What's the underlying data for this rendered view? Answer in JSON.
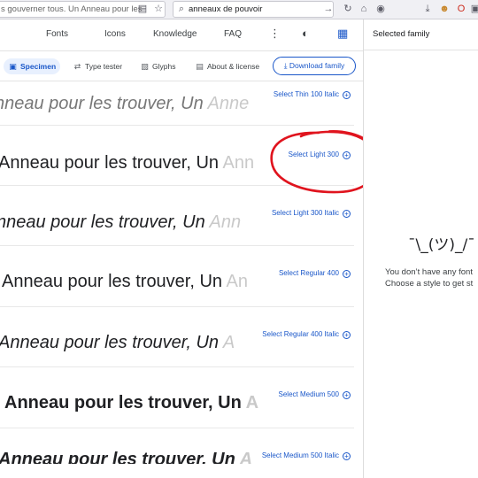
{
  "browser": {
    "tab_url_text": "s gouverner tous. Un Anneau pour les tr",
    "search_text": "anneaux de pouvoir"
  },
  "nav": {
    "fonts": "Fonts",
    "icons": "Icons",
    "knowledge": "Knowledge",
    "faq": "FAQ"
  },
  "tabs": {
    "specimen": "Specimen",
    "type_tester": "Type tester",
    "glyphs": "Glyphs",
    "about": "About & license",
    "download": "Download family"
  },
  "rows": [
    {
      "sample": "nneau pour les trouver, Un Anne",
      "select": "Select Thin 100 Italic"
    },
    {
      "sample": "Anneau pour les trouver, Un Ann",
      "select": "Select Light 300"
    },
    {
      "sample": "nneau pour les trouver, Un Ann",
      "select": "Select Light 300 Italic"
    },
    {
      "sample": "Anneau pour les trouver, Un An",
      "select": "Select Regular 400"
    },
    {
      "sample": "Anneau pour les trouver, Un A",
      "select": "Select Regular 400 Italic"
    },
    {
      "sample": "Anneau pour les trouver, Un A",
      "select": "Select Medium 500"
    },
    {
      "sample": "Anneau pour les trouver, Un A",
      "select": "Select Medium 500 Italic"
    }
  ],
  "side": {
    "title": "Selected family",
    "shrug": "¯\\_(ツ)_/¯",
    "empty_line1": "You don’t have any font",
    "empty_line2": "Choose a style to get st"
  },
  "colors": {
    "accent": "#1a57c9",
    "annotation": "#e0141e"
  }
}
